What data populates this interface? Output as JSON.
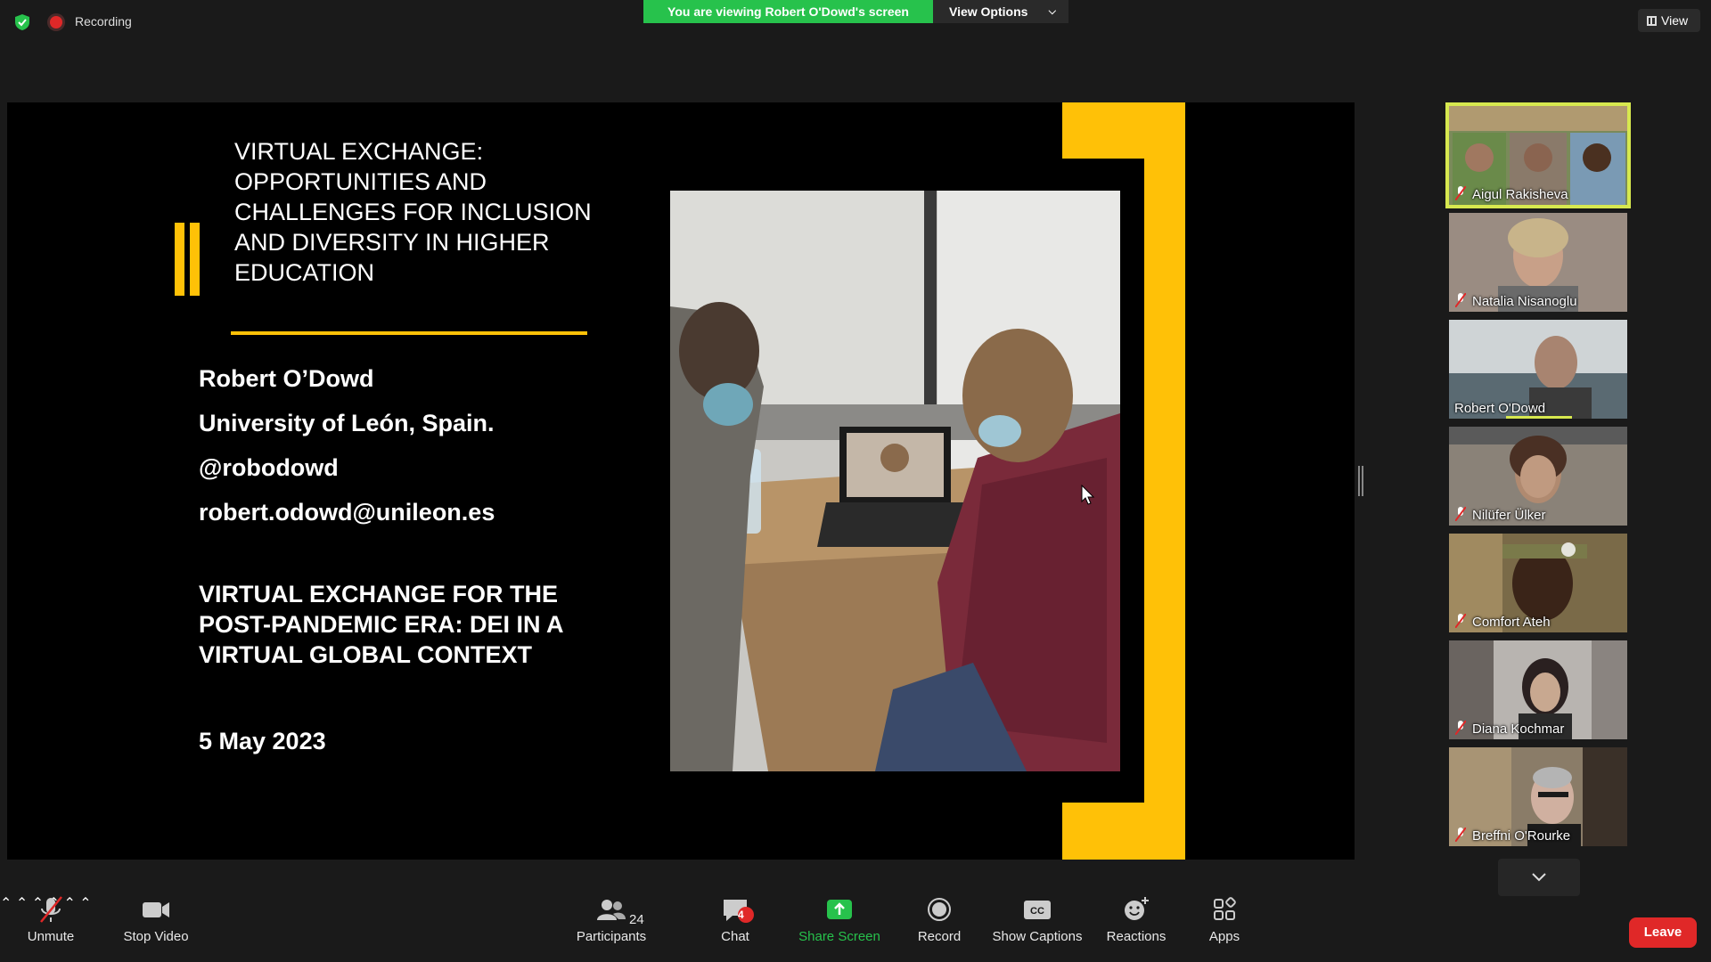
{
  "top_bar": {
    "recording_label": "Recording",
    "viewing_banner": "You are viewing Robert O'Dowd's screen",
    "view_options_label": "View Options",
    "view_label": "View"
  },
  "slide": {
    "title": "VIRTUAL EXCHANGE: OPPORTUNITIES AND CHALLENGES FOR INCLUSION AND DIVERSITY IN HIGHER EDUCATION",
    "presenter": "Robert O’Dowd",
    "affiliation": "University of León, Spain.",
    "handle": "@robodowd",
    "email": "robert.odowd@unileon.es",
    "subtitle": "VIRTUAL EXCHANGE FOR THE POST-PANDEMIC ERA:  DEI IN A VIRTUAL GLOBAL CONTEXT",
    "date": "5 May 2023"
  },
  "participants": [
    {
      "name": "Aigul Rakisheva",
      "muted": true,
      "active": true
    },
    {
      "name": "Natalia Nisanoglu",
      "muted": true
    },
    {
      "name": "Robert O'Dowd",
      "muted": false,
      "speaking": true
    },
    {
      "name": "Nilüfer Ülker",
      "muted": true
    },
    {
      "name": "Comfort Ateh",
      "muted": true
    },
    {
      "name": "Diana Kochmar",
      "muted": true
    },
    {
      "name": "Breffni O'Rourke",
      "muted": true
    }
  ],
  "toolbar": {
    "unmute": "Unmute",
    "stop_video": "Stop Video",
    "participants": "Participants",
    "participants_count": "24",
    "chat": "Chat",
    "chat_badge": "4",
    "share_screen": "Share Screen",
    "record": "Record",
    "show_captions": "Show Captions",
    "cc_text": "CC",
    "reactions": "Reactions",
    "apps": "Apps",
    "leave": "Leave"
  },
  "colors": {
    "green": "#27c24c",
    "yellow": "#ffc107",
    "red": "#e02828",
    "active_outline": "#d7e84f"
  }
}
